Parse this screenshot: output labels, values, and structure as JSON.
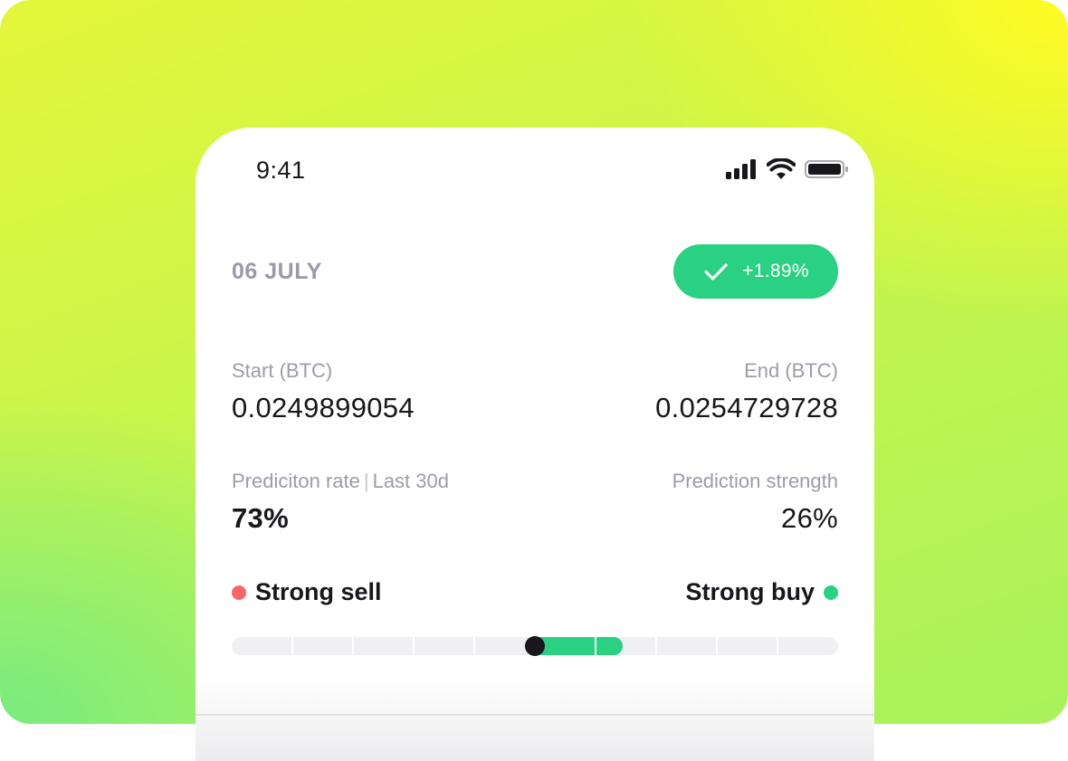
{
  "status_bar": {
    "time": "9:41",
    "signal_icon": "cellular-signal-icon",
    "wifi_icon": "wifi-icon",
    "battery_icon": "battery-icon"
  },
  "prediction": {
    "date": "06 JULY",
    "change_badge": {
      "icon": "check-icon",
      "text": "+1.89%",
      "color": "#2ad182"
    },
    "start": {
      "label": "Start (BTC)",
      "value": "0.0249899054"
    },
    "end": {
      "label": "End (BTC)",
      "value": "0.0254729728"
    },
    "rate": {
      "label": "Prediciton rate",
      "period": "Last 30d",
      "value": "73%"
    },
    "strength": {
      "label": "Prediction strength",
      "value": "26%"
    },
    "scale": {
      "left_label": "Strong sell",
      "right_label": "Strong buy",
      "sell_color": "#fa6565",
      "buy_color": "#2ad182",
      "segments": 10,
      "neutral_position": 0.5,
      "strength_fraction": 0.26
    }
  },
  "colors": {
    "accent_green": "#2ad182",
    "text_dark": "#17171c",
    "text_muted": "#9d9ca9",
    "background_yellow": "#fffb24",
    "background_green": "#78eb80"
  }
}
